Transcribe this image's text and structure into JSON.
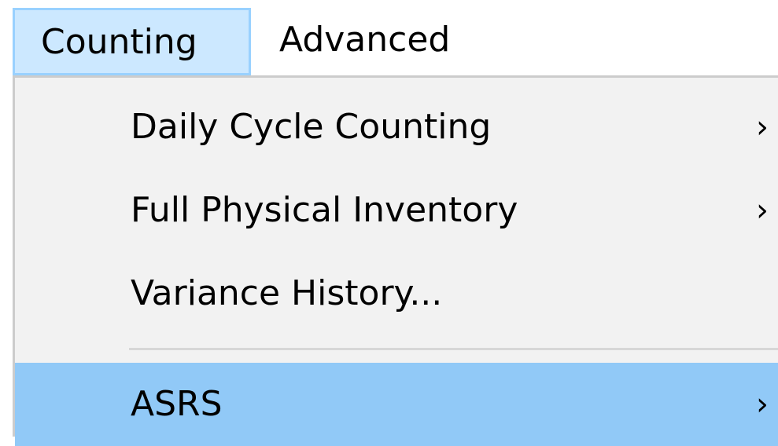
{
  "menubar": {
    "items": [
      {
        "label": "Counting",
        "state": "open"
      },
      {
        "label": "Advanced",
        "state": "normal"
      }
    ]
  },
  "dropdown": {
    "items": [
      {
        "label": "Daily Cycle Counting",
        "submenu_icon": "chevron-right-icon",
        "chevron": "›"
      },
      {
        "label": "Full Physical Inventory",
        "submenu_icon": "chevron-right-icon",
        "chevron": "›"
      },
      {
        "label": "Variance History...",
        "submenu_icon": null
      },
      {
        "label": "ASRS",
        "submenu_icon": "chevron-right-icon",
        "chevron": "›",
        "highlighted": true
      }
    ]
  },
  "colors": {
    "menubar_open_bg": "#cce8ff",
    "menubar_open_border": "#99d1ff",
    "dropdown_bg": "#f2f2f2",
    "highlight_bg": "#91c9f7",
    "separator": "#d7d7d7"
  }
}
